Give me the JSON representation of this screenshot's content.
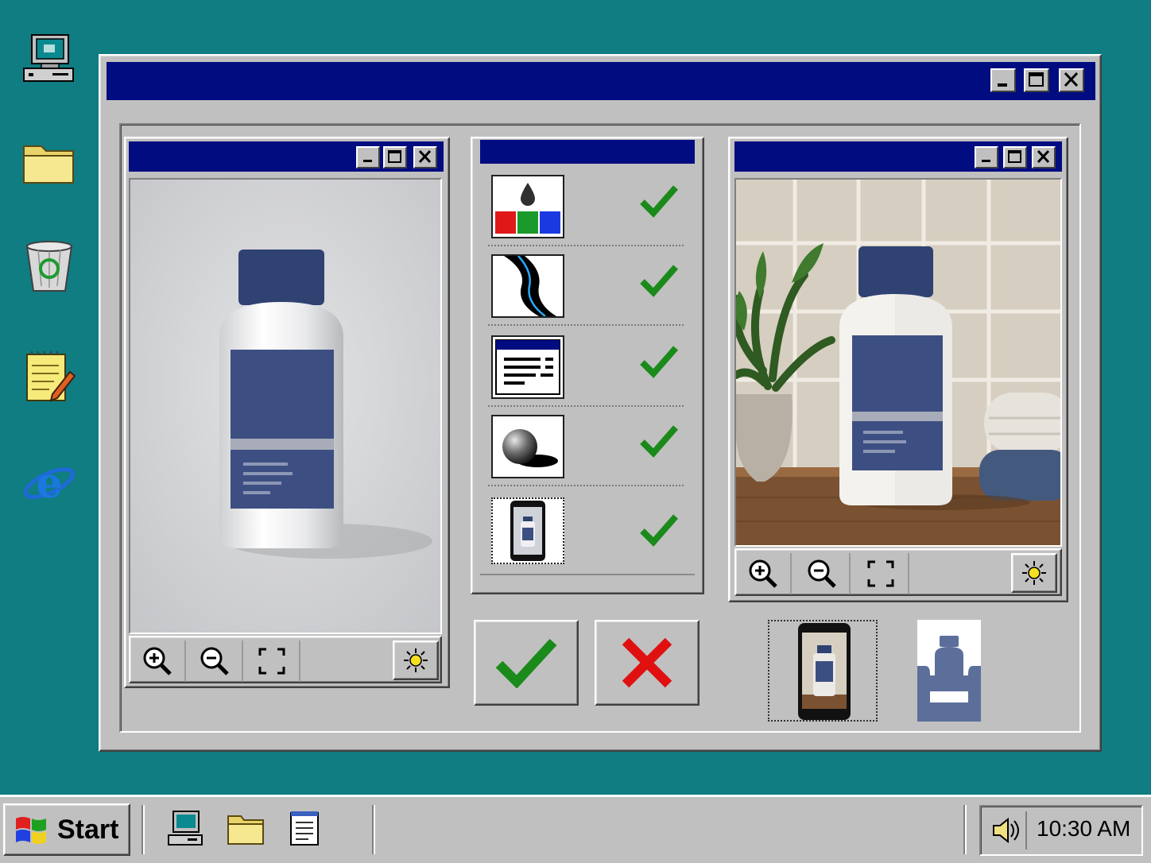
{
  "desktop": {
    "icons": [
      "my-computer-icon",
      "folder-icon",
      "recycle-bin-icon",
      "notepad-icon",
      "internet-explorer-icon"
    ]
  },
  "main_window": {
    "title": "",
    "controls": [
      "minimize-icon",
      "maximize-icon",
      "close-icon"
    ]
  },
  "left_viewer": {
    "title": "",
    "image": "bottle-product-on-gray-background",
    "tools": [
      "zoom-in-icon",
      "zoom-out-icon",
      "fit-screen-icon",
      "brightness-icon"
    ]
  },
  "checklist": {
    "title": "",
    "items": [
      {
        "icon": "color-ink-rgb-icon",
        "status": "check-icon"
      },
      {
        "icon": "path-curve-icon",
        "status": "check-icon"
      },
      {
        "icon": "text-layout-icon",
        "status": "check-icon"
      },
      {
        "icon": "shading-sphere-icon",
        "status": "check-icon"
      },
      {
        "icon": "mobile-preview-icon",
        "status": "check-icon"
      }
    ],
    "accept": "check-icon",
    "reject": "x-icon"
  },
  "right_viewer": {
    "title": "",
    "image": "bottle-product-bathroom-scene",
    "tools": [
      "zoom-in-icon",
      "zoom-out-icon",
      "fit-screen-icon",
      "brightness-icon"
    ],
    "variants": [
      "phone-preview-thumbnail",
      "bottle-silhouette-thumbnail"
    ]
  },
  "taskbar": {
    "start_label": "Start",
    "quick_launch": [
      "my-computer-icon",
      "folder-icon",
      "notepad-icon"
    ],
    "clock": "10:30 AM",
    "tray_icons": [
      "speaker-icon"
    ]
  },
  "colors": {
    "desktop": "#0f7d82",
    "titlebar": "#000c80",
    "face": "#c0c0c0",
    "label_blue": "#3d4f82",
    "check_green": "#1a8a1a",
    "reject_red": "#e01010"
  }
}
